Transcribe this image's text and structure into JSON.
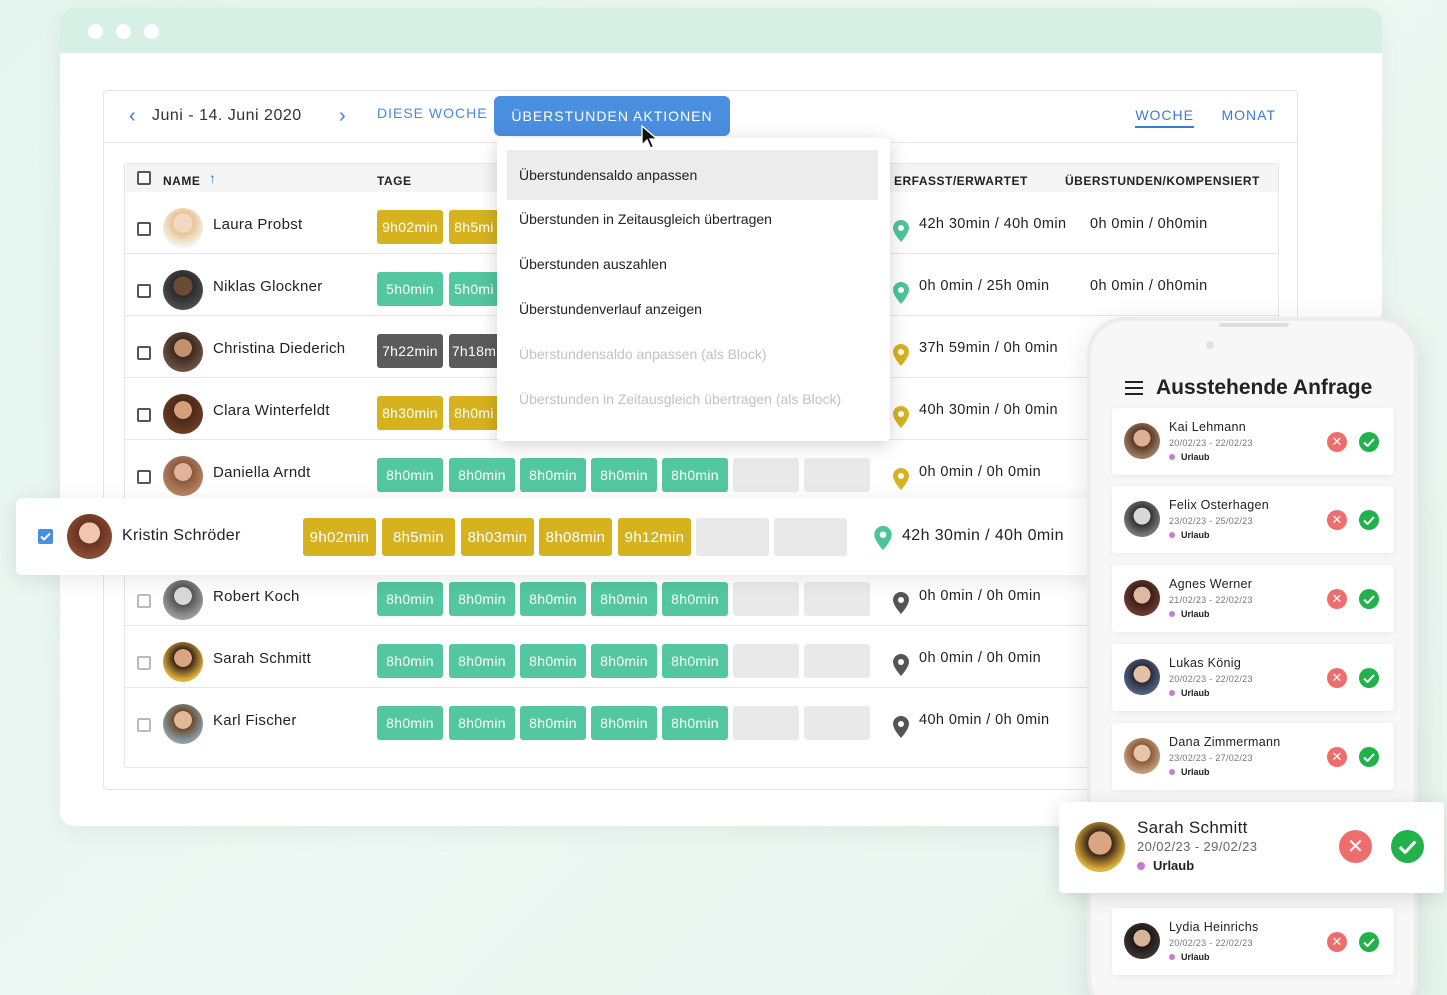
{
  "header": {
    "date_range": "Juni - 14. Juni 2020",
    "this_week": "DIESE WOCHE",
    "actions_button": "ÜBERSTUNDEN AKTIONEN",
    "view_week": "WOCHE",
    "view_month": "MONAT"
  },
  "table": {
    "col_name": "NAME",
    "col_days": "TAGE",
    "col_recorded": "ERFASST/ERWARTET",
    "col_overtime": "ÜBERSTUNDEN/KOMPENSIERT",
    "rows": [
      {
        "name": "Laura Probst",
        "days": [
          "9h02min",
          "8h5mi"
        ],
        "recorded": "42h 30min / 40h 0min",
        "overtime": "0h 0min / 0h0min"
      },
      {
        "name": "Niklas Glockner",
        "days": [
          "5h0min",
          "5h0mi"
        ],
        "recorded": "0h 0min / 25h 0min",
        "overtime": "0h 0min / 0h0min"
      },
      {
        "name": "Christina Diederich",
        "days": [
          "7h22min",
          "7h18m"
        ],
        "recorded": "37h 59min / 0h 0min",
        "overtime": ""
      },
      {
        "name": "Clara Winterfeldt",
        "days": [
          "8h30min",
          "8h0mi"
        ],
        "recorded": "40h 30min / 0h 0min",
        "overtime": ""
      },
      {
        "name": "Daniella Arndt",
        "days": [
          "8h0min",
          "8h0min",
          "8h0min",
          "8h0min",
          "8h0min"
        ],
        "recorded": "0h 0min / 0h 0min",
        "overtime": ""
      },
      {
        "name": "Robert Koch",
        "days": [
          "8h0min",
          "8h0min",
          "8h0min",
          "8h0min",
          "8h0min"
        ],
        "recorded": "0h 0min / 0h 0min",
        "overtime": ""
      },
      {
        "name": "Sarah Schmitt",
        "days": [
          "8h0min",
          "8h0min",
          "8h0min",
          "8h0min",
          "8h0min"
        ],
        "recorded": "0h 0min / 0h 0min",
        "overtime": ""
      },
      {
        "name": "Karl Fischer",
        "days": [
          "8h0min",
          "8h0min",
          "8h0min",
          "8h0min",
          "8h0min"
        ],
        "recorded": "40h 0min / 0h 0min",
        "overtime": ""
      }
    ],
    "highlight": {
      "name": "Kristin Schröder",
      "days": [
        "9h02min",
        "8h5min",
        "8h03min",
        "8h08min",
        "9h12min"
      ],
      "recorded": "42h 30min / 40h 0min"
    }
  },
  "dropdown": {
    "items": [
      {
        "label": "Überstundensaldo anpassen",
        "disabled": false
      },
      {
        "label": "Überstunden in Zeitausgleich übertragen",
        "disabled": false
      },
      {
        "label": "Überstunden auszahlen",
        "disabled": false
      },
      {
        "label": "Überstundenverlauf anzeigen",
        "disabled": false
      },
      {
        "label": "Überstundensaldo anpassen (als Block)",
        "disabled": true
      },
      {
        "label": "Überstunden in Zeitausgleich übertragen (als Block)",
        "disabled": true
      }
    ]
  },
  "phone": {
    "title": "Ausstehende Anfrage",
    "requests": [
      {
        "name": "Kai Lehmann",
        "dates": "20/02/23 - 22/02/23",
        "type": "Urlaub"
      },
      {
        "name": "Felix Osterhagen",
        "dates": "23/02/23 - 25/02/23",
        "type": "Urlaub"
      },
      {
        "name": "Agnes Werner",
        "dates": "21/02/23 - 22/02/23",
        "type": "Urlaub"
      },
      {
        "name": "Lukas König",
        "dates": "20/02/23 - 22/02/23",
        "type": "Urlaub"
      },
      {
        "name": "Dana Zimmermann",
        "dates": "23/02/23 - 27/02/23",
        "type": "Urlaub"
      },
      {
        "name": "Lydia Heinrichs",
        "dates": "20/02/23 - 22/02/23",
        "type": "Urlaub"
      }
    ],
    "highlight": {
      "name": "Sarah Schmitt",
      "dates": "20/02/23 - 29/02/23",
      "type": "Urlaub"
    }
  },
  "colors": {
    "accent": "#4a8ee0",
    "green": "#52c7a0",
    "yellow": "#d6b21e",
    "reject": "#ee6e6e",
    "approve": "#21b24c"
  }
}
